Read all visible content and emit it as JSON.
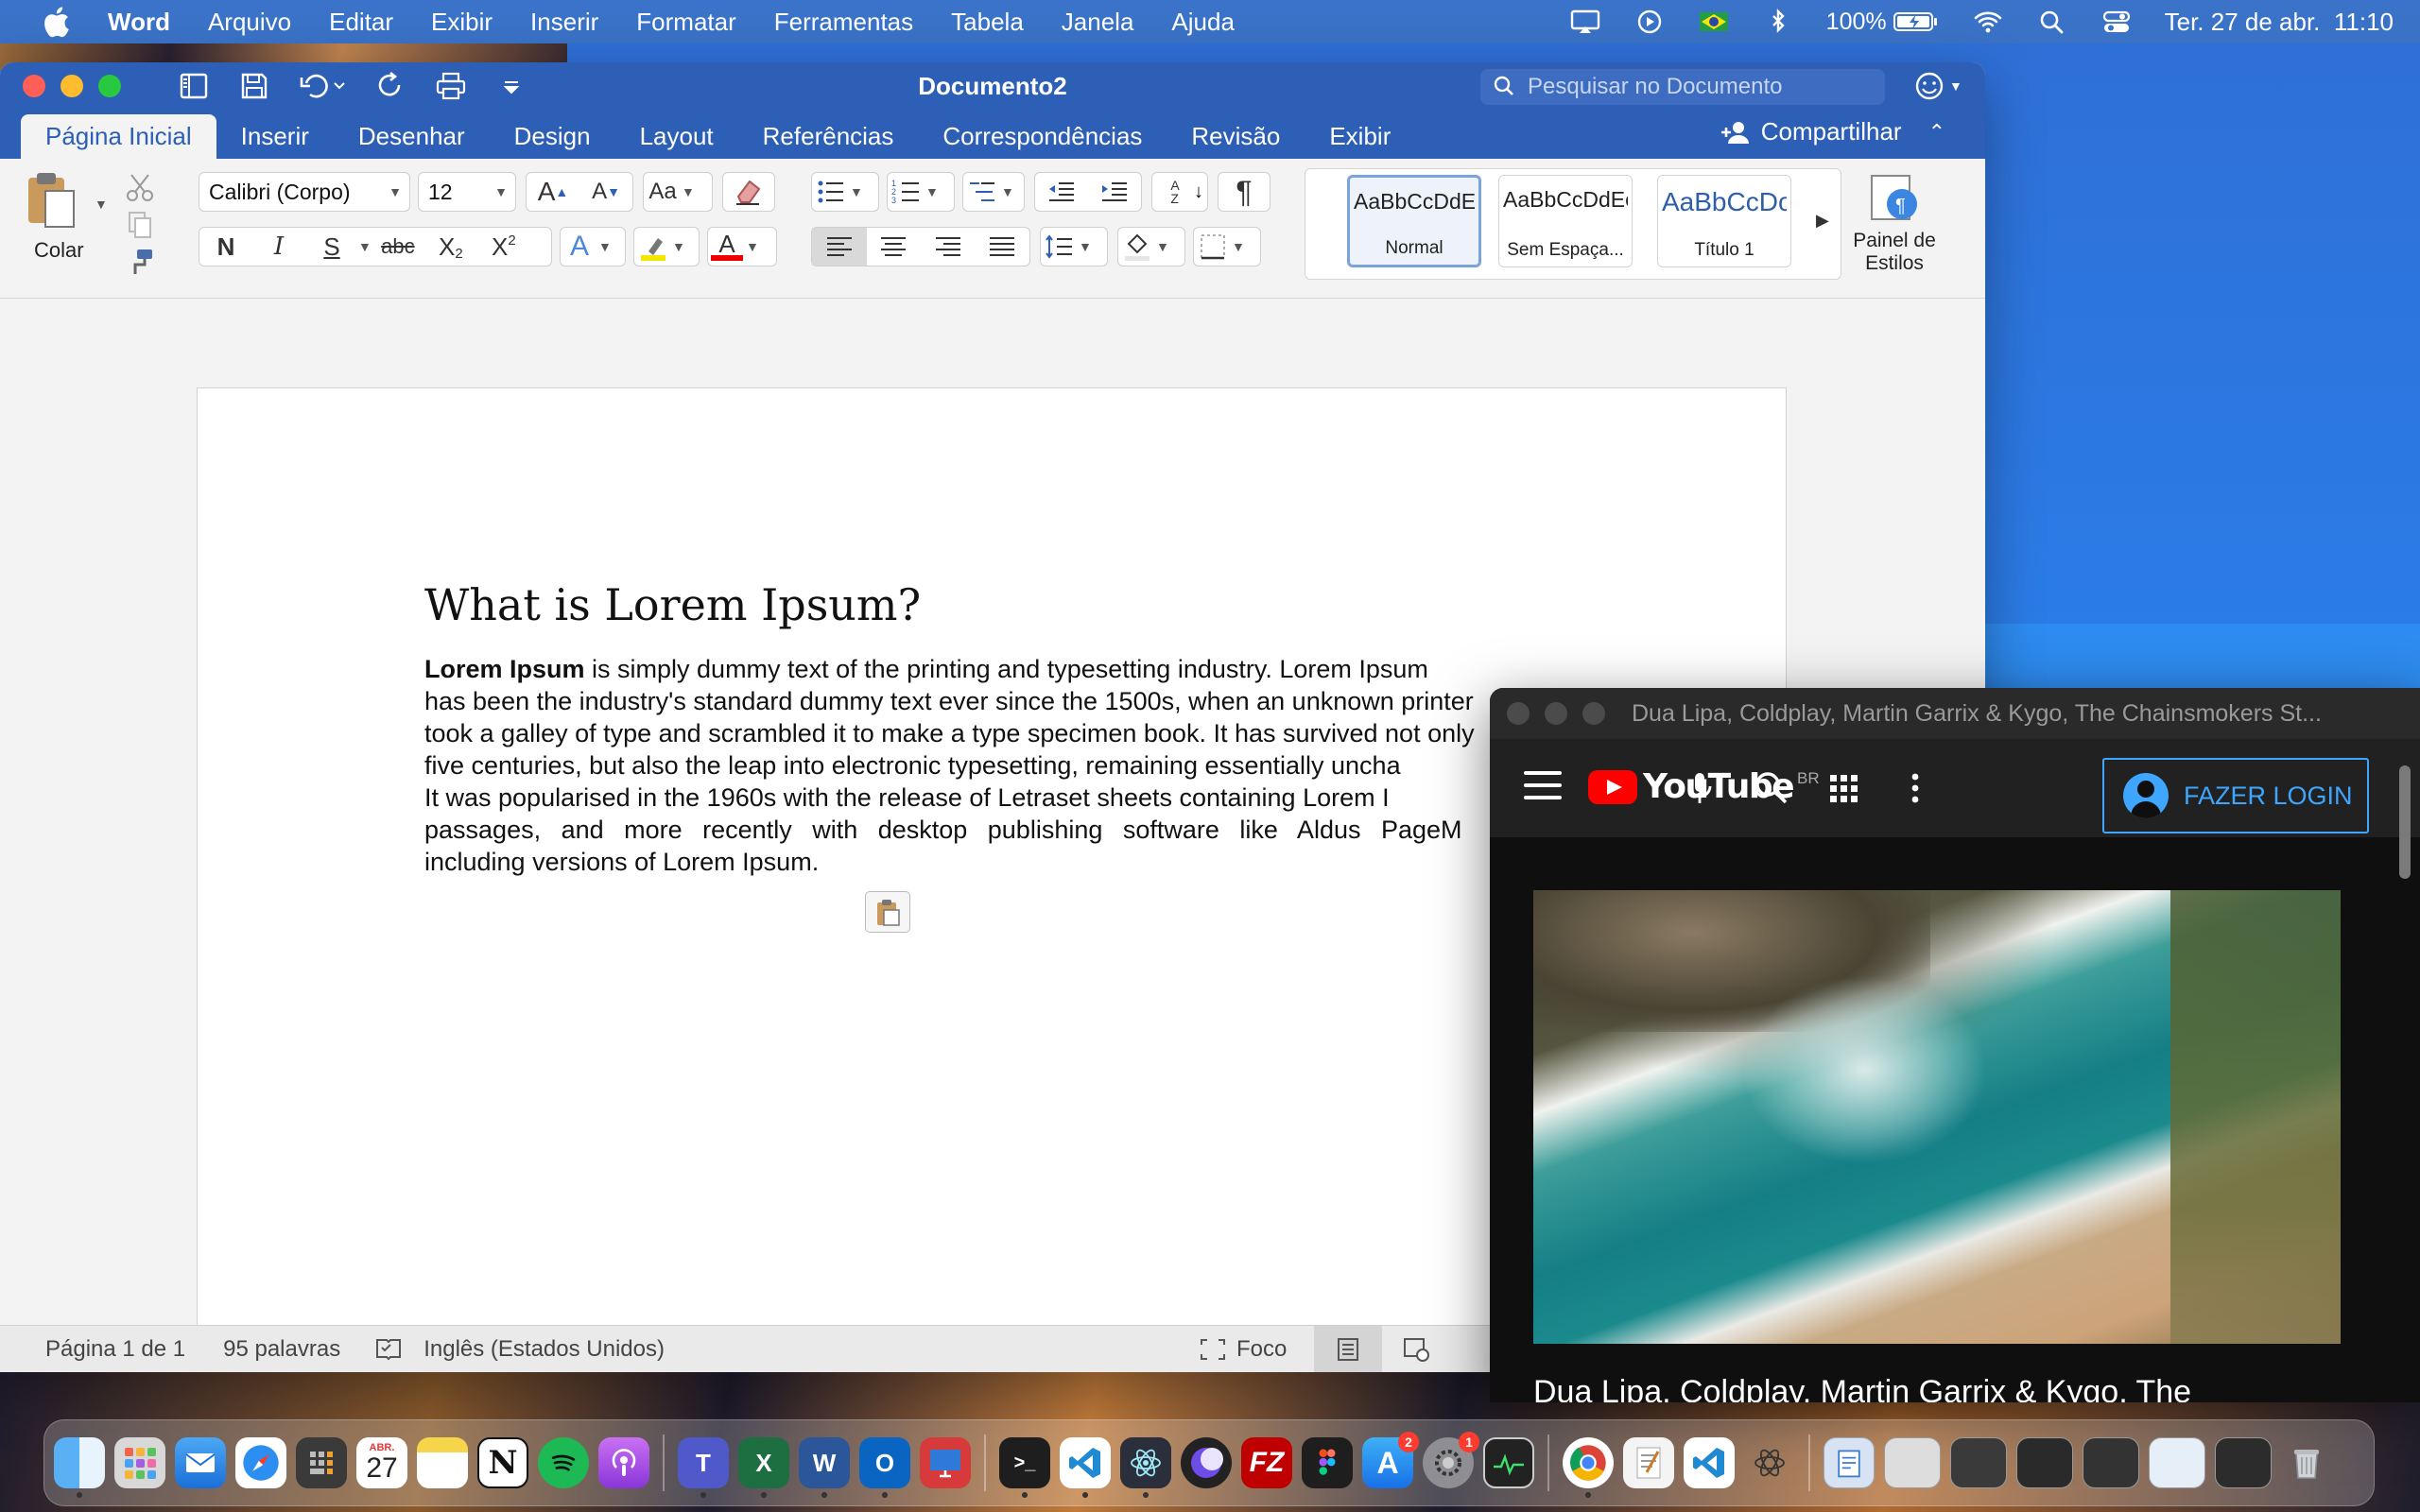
{
  "menubar": {
    "app": "Word",
    "items": [
      "Arquivo",
      "Editar",
      "Exibir",
      "Inserir",
      "Formatar",
      "Ferramentas",
      "Tabela",
      "Janela",
      "Ajuda"
    ],
    "battery": "100%",
    "datetime": "Ter. 27 de abr.  11:10"
  },
  "word": {
    "title": "Documento2",
    "search_placeholder": "Pesquisar no Documento",
    "tabs": [
      "Página Inicial",
      "Inserir",
      "Desenhar",
      "Design",
      "Layout",
      "Referências",
      "Correspondências",
      "Revisão",
      "Exibir"
    ],
    "share": "Compartilhar",
    "ribbon": {
      "paste": "Colar",
      "font_name": "Calibri (Corpo)",
      "font_size": "12",
      "bold": "N",
      "italic": "I",
      "underline": "S",
      "strike": "abc",
      "styles": [
        {
          "sample": "AaBbCcDdEe",
          "name": "Normal"
        },
        {
          "sample": "AaBbCcDdEe",
          "name": "Sem Espaça..."
        },
        {
          "sample": "AaBbCcDc",
          "name": "Título 1"
        }
      ],
      "styles_pane": [
        "Painel de",
        "Estilos"
      ]
    },
    "document": {
      "heading": "What is Lorem Ipsum?",
      "bold_lead": "Lorem Ipsum",
      "lines": [
        " is simply dummy text of the printing and typesetting industry. Lorem Ipsum",
        "has been the industry's standard dummy text ever since the 1500s, when an unknown printer",
        "took a galley of type and scrambled it to make a type specimen book. It has survived not only",
        "five centuries, but also the leap into electronic typesetting, remaining essentially uncha",
        "It was popularised in the 1960s with the release of Letraset sheets containing Lorem I",
        "passages, and more recently with desktop publishing software like Aldus PageM",
        "including versions of Lorem Ipsum."
      ]
    },
    "status": {
      "page": "Página 1 de 1",
      "words": "95 palavras",
      "language": "Inglês (Estados Unidos)",
      "focus": "Foco"
    }
  },
  "youtube": {
    "window_title": "Dua Lipa, Coldplay, Martin Garrix & Kygo, The Chainsmokers St...",
    "logo": "YouTube",
    "region": "BR",
    "login": "FAZER LOGIN",
    "video_title": "Dua Lipa, Coldplay, Martin Garrix & Kygo, The"
  },
  "dock": {
    "calendar_month": "ABR.",
    "calendar_day": "27",
    "badge_appstore": "2",
    "badge_settings": "1"
  }
}
